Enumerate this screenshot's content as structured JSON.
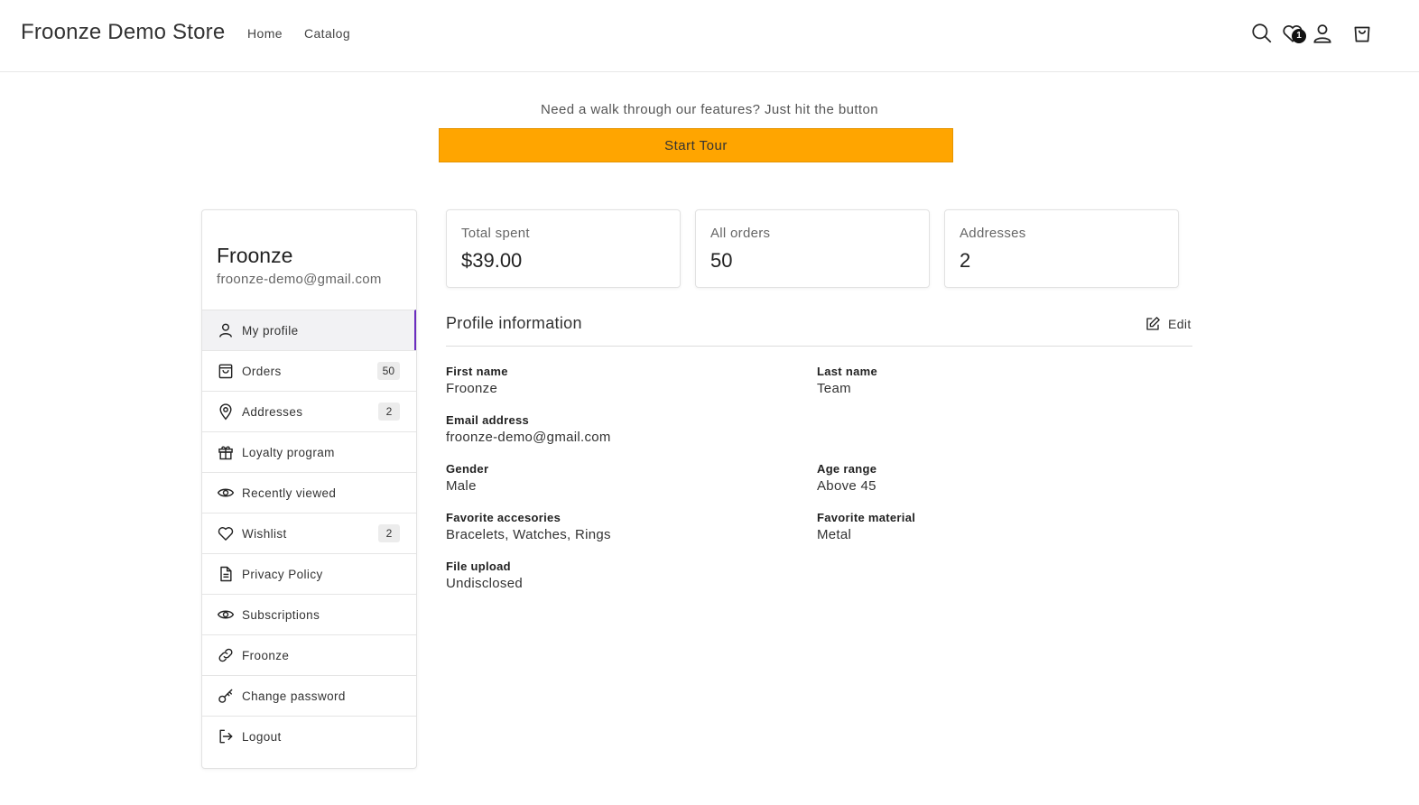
{
  "header": {
    "brand": "Froonze Demo Store",
    "nav": [
      "Home",
      "Catalog"
    ],
    "wishlist_badge": "1"
  },
  "tour": {
    "text": "Need a walk through our features? Just hit the button",
    "button_label": "Start Tour",
    "button_color": "#ffa500"
  },
  "sidebar": {
    "user_name": "Froonze",
    "user_email": "froonze-demo@gmail.com",
    "accent_color": "#6b2dbf",
    "items": [
      {
        "label": "My profile",
        "icon": "user-icon",
        "active": true
      },
      {
        "label": "Orders",
        "icon": "bag-icon",
        "count": "50"
      },
      {
        "label": "Addresses",
        "icon": "location-pin-icon",
        "count": "2"
      },
      {
        "label": "Loyalty program",
        "icon": "gift-icon"
      },
      {
        "label": "Recently viewed",
        "icon": "eye-icon"
      },
      {
        "label": "Wishlist",
        "icon": "heart-icon",
        "count": "2"
      },
      {
        "label": "Privacy Policy",
        "icon": "document-icon"
      },
      {
        "label": "Subscriptions",
        "icon": "eye-icon"
      },
      {
        "label": "Froonze",
        "icon": "link-icon"
      },
      {
        "label": "Change password",
        "icon": "key-icon"
      },
      {
        "label": "Logout",
        "icon": "logout-icon"
      }
    ]
  },
  "stats": [
    {
      "label": "Total spent",
      "value": "$39.00"
    },
    {
      "label": "All orders",
      "value": "50"
    },
    {
      "label": "Addresses",
      "value": "2"
    }
  ],
  "profile": {
    "title": "Profile information",
    "edit_label": "Edit",
    "fields": {
      "first_name": {
        "label": "First name",
        "value": "Froonze"
      },
      "last_name": {
        "label": "Last name",
        "value": "Team"
      },
      "email": {
        "label": "Email address",
        "value": "froonze-demo@gmail.com"
      },
      "gender": {
        "label": "Gender",
        "value": "Male"
      },
      "age_range": {
        "label": "Age range",
        "value": "Above 45"
      },
      "favorite_accessories": {
        "label": "Favorite accesories",
        "value": "Bracelets, Watches, Rings"
      },
      "favorite_material": {
        "label": "Favorite material",
        "value": "Metal"
      },
      "file_upload": {
        "label": "File upload",
        "value": "Undisclosed"
      }
    }
  }
}
